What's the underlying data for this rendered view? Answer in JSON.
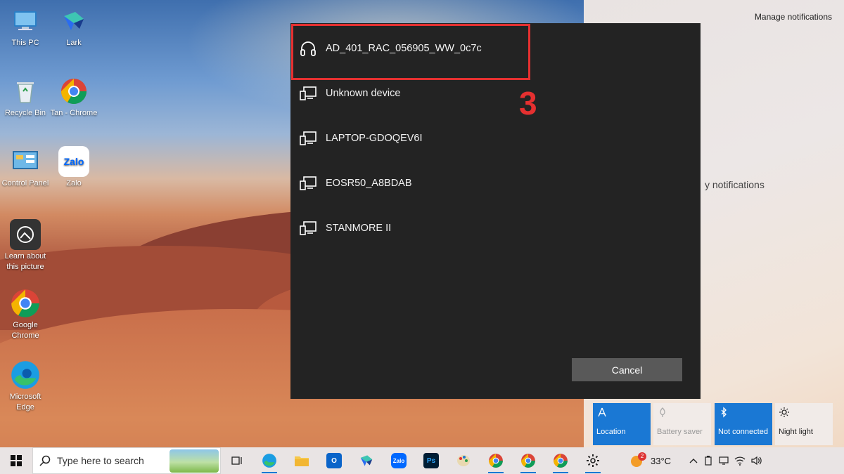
{
  "desktop": {
    "icons": [
      {
        "label": "This PC"
      },
      {
        "label": "Lark"
      },
      {
        "label": "Recycle Bin"
      },
      {
        "label": "Tan - Chrome"
      },
      {
        "label": "Control Panel"
      },
      {
        "label": "Zalo"
      },
      {
        "label": "Learn about this picture"
      },
      {
        "label": "Google Chrome"
      },
      {
        "label": "Microsoft Edge"
      }
    ],
    "zalo_glyph": "Zalo"
  },
  "dialog": {
    "devices": [
      {
        "name": "AD_401_RAC_056905_WW_0c7c",
        "icon": "headphones-icon"
      },
      {
        "name": "Unknown device",
        "icon": "display-device-icon"
      },
      {
        "name": "LAPTOP-GDOQEV6I",
        "icon": "display-device-icon"
      },
      {
        "name": "EOSR50_A8BDAB",
        "icon": "display-device-icon"
      },
      {
        "name": "STANMORE II",
        "icon": "display-device-icon"
      }
    ],
    "cancel_label": "Cancel",
    "annotation_step": "3",
    "highlight_color": "#e53030"
  },
  "action_center": {
    "manage_notifications": "Manage notifications",
    "no_notifications": "y notifications",
    "tiles": [
      {
        "label": "Location",
        "icon": "location-icon",
        "state": "on"
      },
      {
        "label": "Battery saver",
        "icon": "battery-saver-icon",
        "state": "disabled"
      },
      {
        "label": "Not connected",
        "icon": "bluetooth-icon",
        "state": "on"
      },
      {
        "label": "Night light",
        "icon": "night-light-icon",
        "state": "off"
      }
    ],
    "accent": "#1a78d4"
  },
  "taskbar": {
    "search_placeholder": "Type here to search",
    "apps": [
      "task-view",
      "edge",
      "file-explorer",
      "outlook",
      "lark",
      "zalo",
      "photoshop",
      "paint",
      "chrome-profile-1",
      "chrome-profile-2",
      "chrome-profile-3",
      "settings"
    ],
    "zalo_label": "Zalo",
    "ps_label": "Ps",
    "weather_badge": "2",
    "temperature": "33°C"
  }
}
